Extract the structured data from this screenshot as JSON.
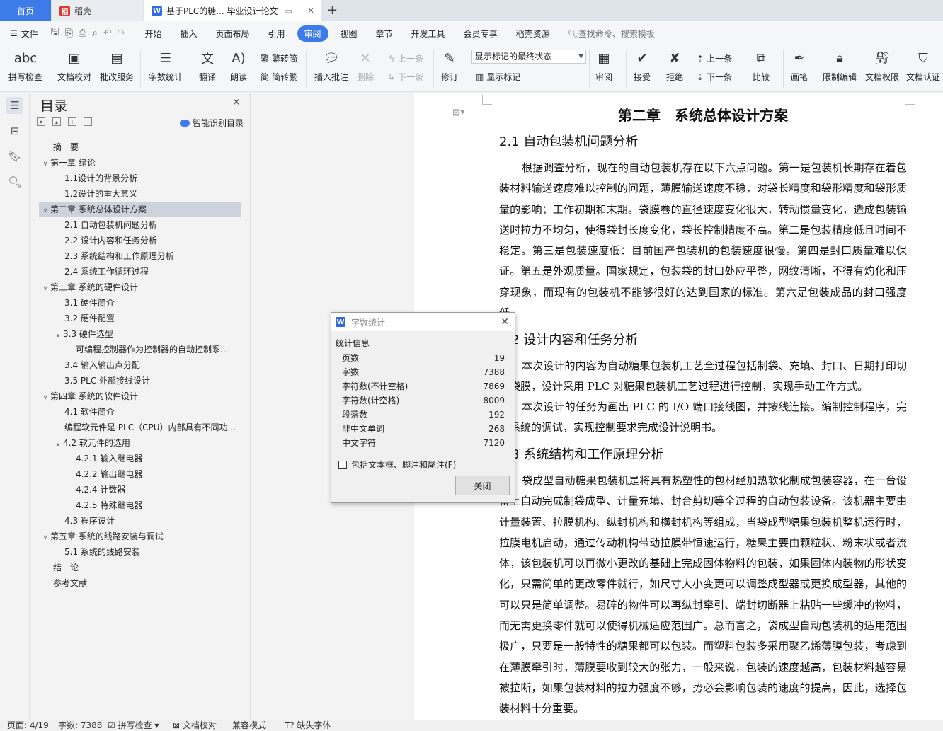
{
  "tabs": {
    "home": "首页",
    "daoke": "稻壳",
    "doc": "基于PLC的糖... 毕业设计论文"
  },
  "menubar": {
    "file": "文件",
    "items": [
      "开始",
      "插入",
      "页面布局",
      "引用",
      "审阅",
      "视图",
      "章节",
      "开发工具",
      "会员专享",
      "稻壳资源"
    ],
    "search": "查找命令、搜索模板"
  },
  "ribbon": {
    "spell": "拼写检查",
    "proof": "文档校对",
    "batch": "批改服务",
    "wordcount": "字数统计",
    "translate": "翻译",
    "read": "朗读",
    "trad": "繁转简",
    "simp": "简转繁",
    "insert_comment": "插入批注",
    "delete": "删除",
    "prev": "上一条",
    "next": "下一条",
    "track": "修订",
    "markup_state": "显示标记的最终状态",
    "show_markup": "显示标记",
    "review": "审阅",
    "accept": "接受",
    "reject": "拒绝",
    "prev2": "上一条",
    "next2": "下一条",
    "compare": "比较",
    "pen": "画笔",
    "restrict": "限制编辑",
    "rights": "文档权限",
    "cert": "文档认证"
  },
  "toc": {
    "title": "目录",
    "smart": "智能识别目录",
    "items": [
      "摘　要",
      "第一章 绪论",
      "1.1设计的背景分析",
      "1.2设计的重大意义",
      "第二章 系统总体设计方案",
      "2.1 自动包装机问题分析",
      "2.2 设计内容和任务分析",
      "2.3 系统结构和工作原理分析",
      "2.4 系统工作循环过程",
      "第三章 系统的硬件设计",
      "3.1 硬件简介",
      "3.2 硬件配置",
      "3.3 硬件选型",
      "可编程控制器作为控制器的自动控制系...",
      "3.4 输入输出点分配",
      "3.5 PLC 外部接线设计",
      "第四章 系统的软件设计",
      "4.1 软件简介",
      "编程软元件是 PLC（CPU）内部具有不同功...",
      "4.2 软元件的选用",
      "4.2.1 输入继电器",
      "4.2.2 输出继电器",
      "4.2.4 计数器",
      "4.2.5 特殊继电器",
      "4.3 程序设计",
      "第五章 系统的线路安装与调试",
      "5.1 系统的线路安装",
      "结　论",
      "参考文献"
    ]
  },
  "document": {
    "chapter": "第二章　系统总体设计方案",
    "sec1": "2.1 自动包装机问题分析",
    "p1": "根据调查分析，现在的自动包装机存在以下六点问题。第一是包装机长期存在着包装材料输送速度难以控制的问题，薄膜输送速度不稳，对袋长精度和袋形精度和袋形质量的影响；工作初期和末期。袋膜卷的直径速度变化很大，转动惯量变化，造成包装输送时拉力不均匀，使得袋封长度变化，袋长控制精度不高。第二是包装精度低且时间不稳定。第三是包装速度低：目前国产包装机的包装速度很慢。第四是封口质量难以保证。第五是外观质量。国家规定，包装袋的封口处应平整，网纹清晰，不得有灼化和压穿现象，而现有的包装机不能够很好的达到国家的标准。第六是包装成品的封口强度低。",
    "sec2": "2.2 设计内容和任务分析",
    "p2": "本次设计的内容为自动糖果包装机工艺全过程包括制袋、充填、封口、日期打印切断袋膜，设计采用 PLC 对糖果包装机工艺过程进行控制，实现手动工作方式。",
    "p3": "本次设计的任务为画出 PLC 的 I/O 端口接线图，并按线连接。编制控制程序，完成系统的调试，实现控制要求完成设计说明书。",
    "sec3": "2.3 系统结构和工作原理分析",
    "p4": "袋成型自动糖果包装机是将具有热塑性的包材经加热软化制成包装容器，在一台设备上自动完成制袋成型、计量充填、封合剪切等全过程的自动包装设备。该机器主要由计量装置、拉膜机构、纵封机构和横封机构等组成，当袋成型糖果包装机整机运行时，拉膜电机启动，通过传动机构带动拉膜带恒速运行，糖果主要由颗粒状、粉末状或者流体，该包装机可以再微小更改的基础上完成固体物料的包装，如果固体内装物的形状变化，只需简单的更改零件就行，如尺寸大小变更可以调整成型器或更换成型器，其他的可以只是简单调整。易碎的物件可以再纵封牵引、端封切断器上粘贴一些缓冲的物料，而无需更换零件就可以使得机械适应范围广。总而言之，袋成型自动包装机的适用范围极广，只要是一般特性的糖果都可以包装。而塑料包装多采用聚乙烯薄膜包装，考虑到在薄膜牵引时，薄膜要收到较大的张力，一般来说，包装的速度越高，包装材料越容易被拉断，如果包装材料的拉力强度不够，势必会影响包装的速度的提高，因此，选择包装材料十分重要。"
  },
  "dialog": {
    "title": "字数统计",
    "group": "统计信息",
    "rows": [
      {
        "label": "页数",
        "value": "19"
      },
      {
        "label": "字数",
        "value": "7388"
      },
      {
        "label": "字符数(不计空格)",
        "value": "7869"
      },
      {
        "label": "字符数(计空格)",
        "value": "8009"
      },
      {
        "label": "段落数",
        "value": "192"
      },
      {
        "label": "非中文单词",
        "value": "268"
      },
      {
        "label": "中文字符",
        "value": "7120"
      }
    ],
    "checkbox": "包括文本框、脚注和尾注(F)",
    "close": "关闭"
  },
  "status": {
    "page": "页面: 4/19",
    "words": "字数: 7388",
    "spell": "拼写检查",
    "proof": "文档校对",
    "compat": "兼容模式",
    "font": "缺失字体"
  },
  "colors": {
    "accent": "#3c7be8",
    "selected": "#cdd3dc"
  }
}
